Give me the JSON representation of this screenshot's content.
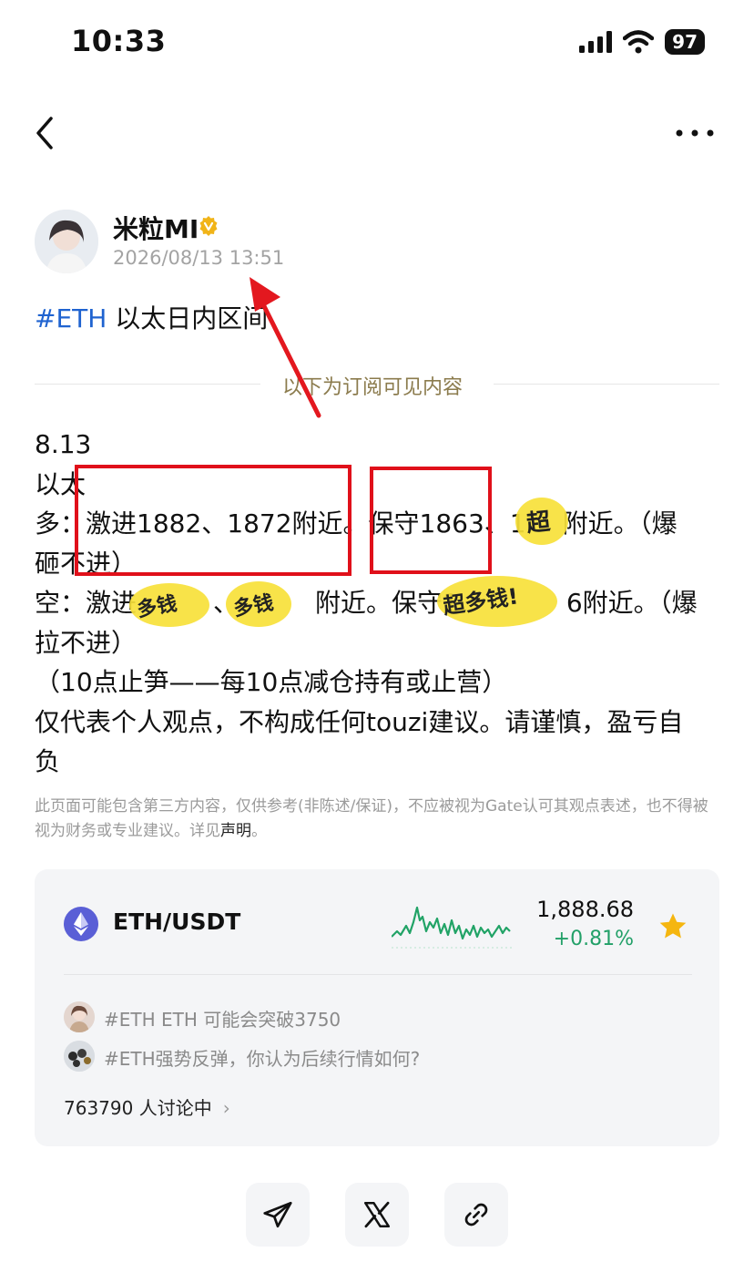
{
  "status": {
    "time": "10:33",
    "battery": "97"
  },
  "author": {
    "name": "米粒MI",
    "time": "2026/08/13 13:51"
  },
  "post": {
    "tag": "#ETH",
    "title": " 以太日内区间",
    "divider_label": "以下为订阅可见内容",
    "lines": [
      "8.13",
      "以太",
      "多：激进1882、1872附近。保守1863、1",
      "砸不进）",
      "空：激进",
      "拉不进）",
      "（10点止笋——每10点减仓持有或止营）",
      "仅代表个人观点，不构成任何touzi建议。请谨慎，盈亏自",
      "负"
    ],
    "line3_tail": "附近。（爆",
    "line5_mid1": "、",
    "line5_mid2": "附近。保守1",
    "line5_tail": "6附近。（爆",
    "disclaimer": "此页面可能包含第三方内容，仅供参考(非陈述/保证)，不应被视为Gate认可其观点表述，也不得被视为财务或专业建议。详见",
    "disclaimer_link": "声明",
    "disclaimer_end": "。"
  },
  "stickers": {
    "s1": "超",
    "s2": "多钱",
    "s3": "多钱",
    "s4": "超多钱!"
  },
  "market": {
    "pair": "ETH/USDT",
    "price": "1,888.68",
    "change": "+0.81%",
    "change_color": "#22a068",
    "favorite": true,
    "topics": [
      "#ETH ETH 可能会突破3750",
      "#ETH强势反弹，你认为后续行情如何?"
    ],
    "discussing": "763790 人讨论中"
  },
  "share": [
    "telegram-icon",
    "x-icon",
    "link-icon"
  ]
}
